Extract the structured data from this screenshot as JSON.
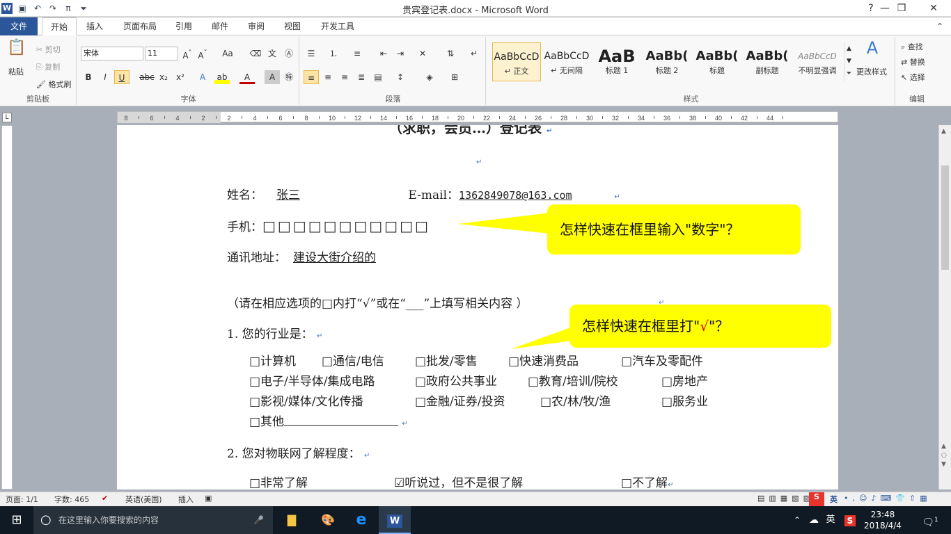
{
  "window": {
    "title": "贵宾登记表.docx - Microsoft Word",
    "logo": "W"
  },
  "quick_access": [
    "save-icon",
    "undo-icon",
    "redo-icon",
    "pi-icon",
    "customize-icon"
  ],
  "window_controls": {
    "help": "?",
    "minimize": "—",
    "restore": "❐",
    "close": "✕"
  },
  "tabs": [
    "文件",
    "开始",
    "插入",
    "页面布局",
    "引用",
    "邮件",
    "审阅",
    "视图",
    "开发工具"
  ],
  "ribbon": {
    "clipboard": {
      "label": "剪贴板",
      "paste": "粘贴",
      "cut": "剪切",
      "copy": "复制",
      "format_painter": "格式刷"
    },
    "font": {
      "label": "字体",
      "name": "宋体",
      "size": "11"
    },
    "paragraph": {
      "label": "段落"
    },
    "styles": {
      "label": "样式",
      "items": [
        {
          "preview": "AaBbCcD",
          "name": "↵ 正文"
        },
        {
          "preview": "AaBbCcD",
          "name": "↵ 无间隔"
        },
        {
          "preview": "AaB",
          "name": "标题 1"
        },
        {
          "preview": "AaBb(",
          "name": "标题 2"
        },
        {
          "preview": "AaBb(",
          "name": "标题"
        },
        {
          "preview": "AaBb(",
          "name": "副标题"
        },
        {
          "preview": "AaBbCcD",
          "name": "不明显强调"
        }
      ],
      "change": "更改样式"
    },
    "editing": {
      "label": "编辑",
      "find": "查找",
      "replace": "替换",
      "select": "选择"
    }
  },
  "ruler_numbers": [
    "8",
    "6",
    "4",
    "2",
    "2",
    "4",
    "6",
    "8",
    "10",
    "12",
    "14",
    "16",
    "18",
    "20",
    "22",
    "24",
    "26",
    "28",
    "30",
    "32",
    "34",
    "36",
    "38",
    "40",
    "42",
    "44"
  ],
  "document": {
    "heading": "（求职，会员…）登记表",
    "name_label": "姓名：",
    "name_value": "张三",
    "email_label": "E-mail：",
    "email_value": "1362849078@163.com",
    "phone_label": "手机：",
    "phone_boxes": "□□□□□□□□□□□",
    "address_label": "通讯地址：",
    "address_value": "建设大街介绍的",
    "instruction": "（请在相应选项的□内打“√”或在“___”上填写相关内容 ）",
    "q1": "1.  您的行业是：",
    "q1_options": [
      [
        "□计算机",
        "□通信/电信",
        "□批发/零售",
        "□快速消费品",
        "□汽车及零配件"
      ],
      [
        "□电子/半导体/集成电路",
        "□政府公共事业",
        "□教育/培训/院校",
        "□房地产"
      ],
      [
        "□影视/媒体/文化传播",
        "□金融/证券/投资",
        "□农/林/牧/渔",
        "□服务业"
      ],
      [
        "□其他"
      ]
    ],
    "q2": "2.  您对物联网了解程度：",
    "q2_options": [
      "□非常了解",
      "☑听说过，但不是很了解",
      "□不了解"
    ],
    "paragraph_mark": "↵"
  },
  "callouts": {
    "first": "怎样快速在框里输入\"数字\"？",
    "second_a": "怎样快速在框里打\"",
    "second_check": "√",
    "second_b": "\"？"
  },
  "status": {
    "page": "页面: 1/1",
    "words": "字数: 465",
    "lang": "英语(美国)",
    "mode": "插入"
  },
  "taskbar": {
    "search_placeholder": "在这里输入你要搜索的内容",
    "time": "23:48",
    "date": "2018/4/4",
    "ime": "英",
    "notifications": "1"
  },
  "colors": {
    "word_blue": "#2b579a",
    "callout_yellow": "#ffff00",
    "taskbar": "#101a24"
  }
}
